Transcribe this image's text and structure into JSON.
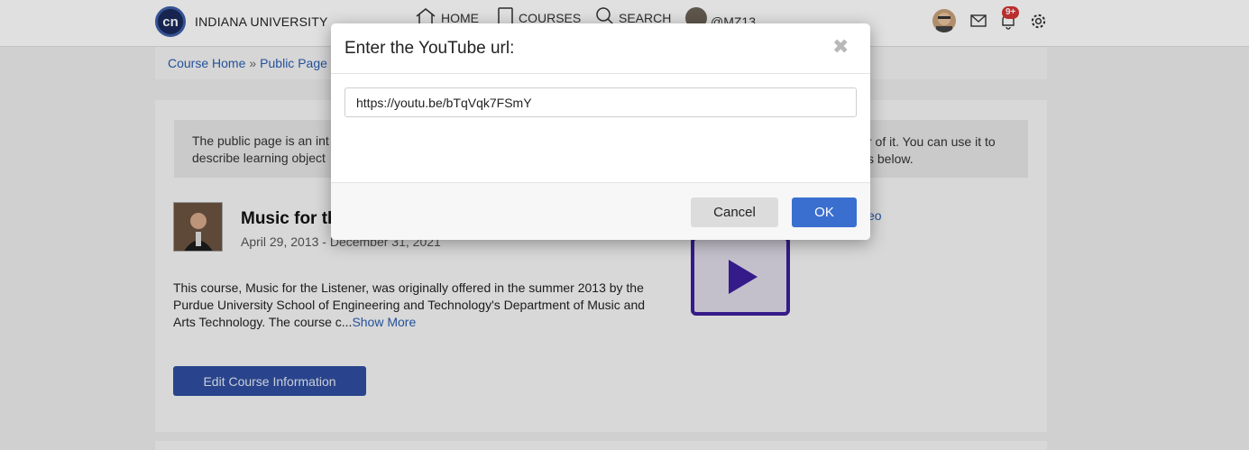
{
  "nav": {
    "brand": "INDIANA UNIVERSITY",
    "logo_text": "cn",
    "home": "HOME",
    "courses": "COURSES",
    "search": "SEARCH",
    "user": "@MZ13",
    "notifications_badge": "9+"
  },
  "breadcrumb": {
    "home": "Course Home",
    "sep": "»",
    "current": "Public Page"
  },
  "info": {
    "left_text_1": "The public page is an int",
    "left_text_2": "describe learning object",
    "right_text_1": "r of it. You can use it to",
    "right_text_2": "s below."
  },
  "course": {
    "title": "Music for th",
    "dates": "April 29, 2013 - December 31, 2021",
    "description": "This course, Music for the Listener, was originally offered in the summer 2013 by the Purdue University School of Engineering and Technology's Department of Music and Arts Technology. The course c...",
    "show_more": "Show More",
    "video_link": "eo",
    "edit_button": "Edit Course Information"
  },
  "modal": {
    "title": "Enter the YouTube url:",
    "close": "✖",
    "input_value": "https://youtu.be/bTqVqk7FSmY",
    "cancel": "Cancel",
    "ok": "OK"
  },
  "colors": {
    "accent": "#3a6fd0",
    "edit_button": "#2f4ea0",
    "play_icon": "#3d1f9c",
    "link": "#2a5db0"
  }
}
